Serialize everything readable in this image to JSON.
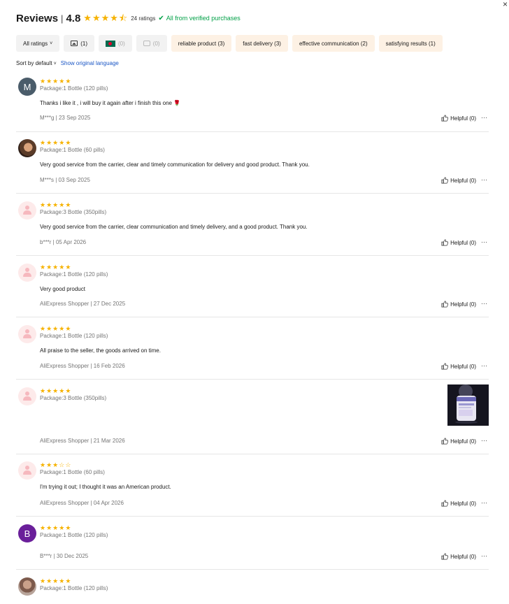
{
  "close_label": "×",
  "header": {
    "title": "Reviews",
    "separator": "|",
    "score": "4.8",
    "ratings_count": "24 ratings",
    "verified_text": "All from verified purchases",
    "star_color": "#f6b200",
    "verified_color": "#00a046"
  },
  "filters": {
    "all_ratings": "All ratings",
    "images_count": "(1)",
    "country_count": "(0)",
    "comments_count": "(0)",
    "tags": [
      "reliable product (3)",
      "fast delivery (3)",
      "effective communication (2)",
      "satisfying results (1)"
    ]
  },
  "sort": {
    "label": "Sort by default",
    "show_original": "Show original language",
    "link_color": "#1a56c5"
  },
  "reviews": [
    {
      "avatar_letter": "M",
      "rating": 5,
      "package": "Package:1 Bottle (120 pills)",
      "text": "Thanks i like it , i will buy it again after i finish this one 🌹",
      "meta": "M***g | 23 Sep 2025",
      "helpful": "Helpful (0)",
      "more": "···"
    },
    {
      "avatar_letter": "",
      "rating": 5,
      "package": "Package:1 Bottle (60 pills)",
      "text": "Very good service from the carrier, clear and timely communication for delivery and good product. Thank you.",
      "meta": "M***s | 03 Sep 2025",
      "helpful": "Helpful (0)",
      "more": "···"
    },
    {
      "avatar_letter": "",
      "rating": 5,
      "package": "Package:3 Bottle (350pills)",
      "text": "Very good service from the carrier, clear communication and timely delivery, and a good product. Thank you.",
      "meta": "b***r | 05 Apr 2026",
      "helpful": "Helpful (0)",
      "more": "···"
    },
    {
      "avatar_letter": "",
      "rating": 5,
      "package": "Package:1 Bottle (120 pills)",
      "text": "Very good product",
      "meta": "AliExpress Shopper | 27 Dec 2025",
      "helpful": "Helpful (0)",
      "more": "···"
    },
    {
      "avatar_letter": "",
      "rating": 5,
      "package": "Package:1 Bottle (120 pills)",
      "text": "All praise to the seller, the goods arrived on time.",
      "meta": "AliExpress Shopper | 16 Feb 2026",
      "helpful": "Helpful (0)",
      "more": "···"
    },
    {
      "avatar_letter": "",
      "rating": 5,
      "package": "Package:3 Bottle (350pills)",
      "text": "",
      "meta": "AliExpress Shopper | 21 Mar 2026",
      "helpful": "Helpful (0)",
      "more": "···"
    },
    {
      "avatar_letter": "",
      "rating": 3,
      "package": "Package:1 Bottle (60 pills)",
      "text": "I'm trying it out; I thought it was an American product.",
      "meta": "AliExpress Shopper | 04 Apr 2026",
      "helpful": "Helpful (0)",
      "more": "···"
    },
    {
      "avatar_letter": "B",
      "rating": 5,
      "package": "Package:1 Bottle (120 pills)",
      "text": "",
      "meta": "B***r | 30 Dec 2025",
      "helpful": "Helpful (0)",
      "more": "···"
    },
    {
      "avatar_letter": "",
      "rating": 5,
      "package": "Package:1 Bottle (120 pills)",
      "text": "",
      "meta": "",
      "helpful": "",
      "more": ""
    }
  ]
}
